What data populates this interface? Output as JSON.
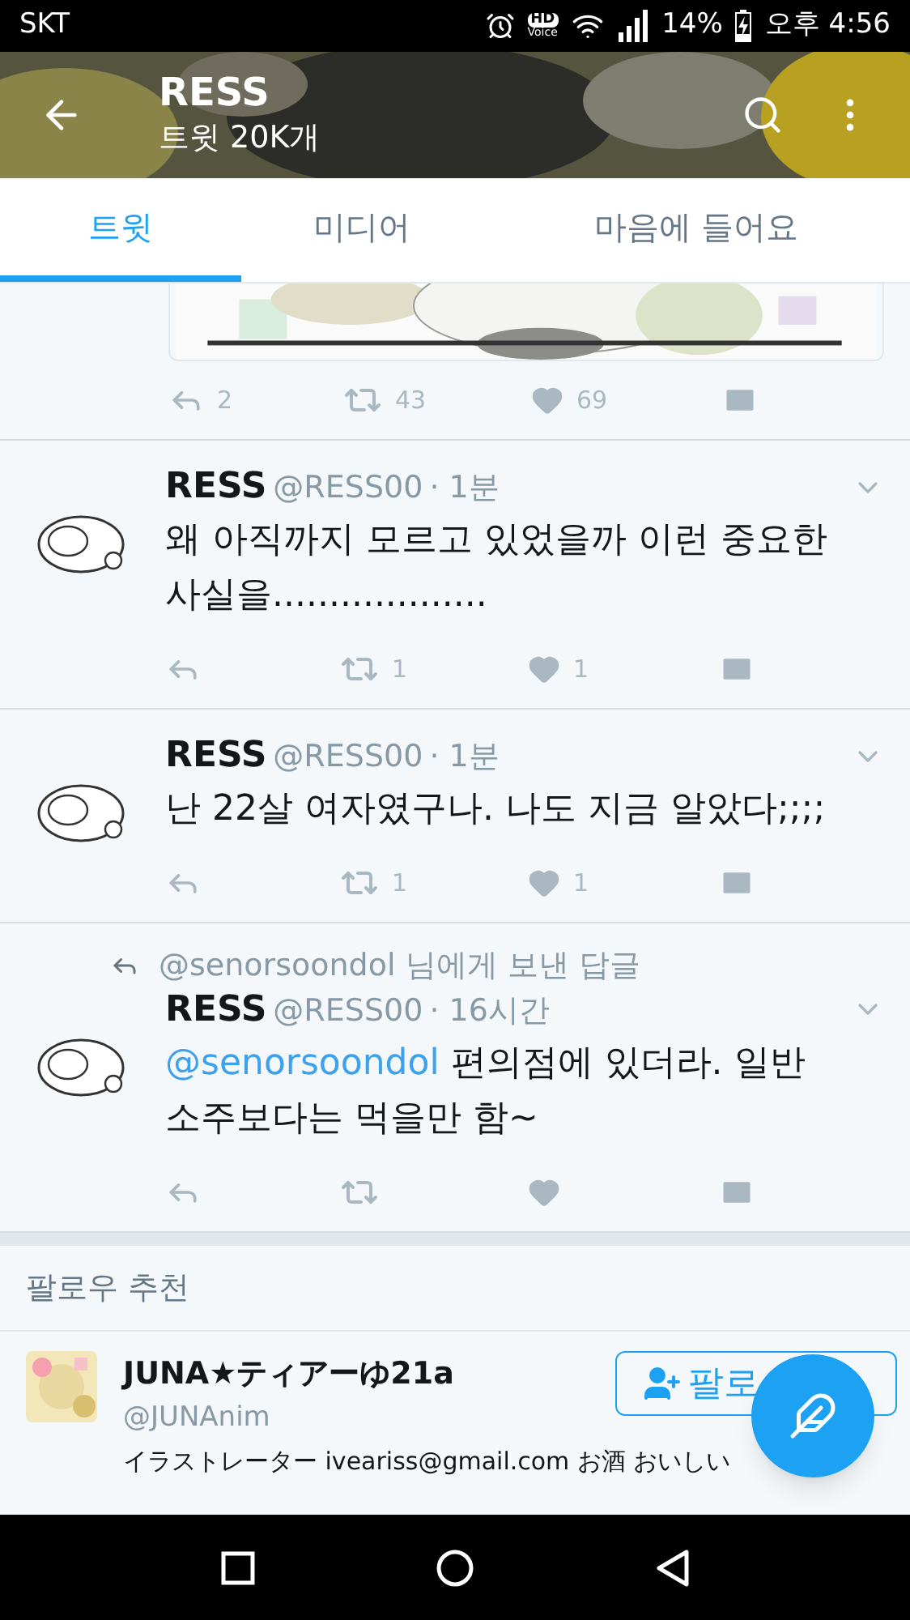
{
  "status_bar": {
    "carrier": "SKT",
    "hd": "HD",
    "voice": "Voice",
    "battery": "14%",
    "time": "오후 4:56"
  },
  "header": {
    "title": "RESS",
    "subtitle": "트윗 20K개"
  },
  "tabs": [
    {
      "label": "트윗",
      "selected": true
    },
    {
      "label": "미디어",
      "selected": false
    },
    {
      "label": "마음에 들어요",
      "selected": false
    }
  ],
  "partial_tweet": {
    "replies": "2",
    "retweets": "43",
    "likes": "69"
  },
  "tweets": [
    {
      "name": "RESS",
      "handle": "@RESS00",
      "time": "· 1분",
      "text": "왜 아직까지 모르고 있었을까 이런 중요한 사실을...................",
      "retweets": "1",
      "likes": "1"
    },
    {
      "name": "RESS",
      "handle": "@RESS00",
      "time": "· 1분",
      "text": "난 22살 여자였구나.  나도 지금 알았다;;;;",
      "retweets": "1",
      "likes": "1"
    },
    {
      "reply_to": "@senorsoondol 님에게 보낸 답글",
      "name": "RESS",
      "handle": "@RESS00",
      "time": "· 16시간",
      "mention": "@senorsoondol",
      "text": "편의점에 있더라.  일반 소주보다는 먹을만 함~"
    }
  ],
  "suggestions": {
    "title": "팔로우 추천",
    "users": [
      {
        "name": "JUNA★ティアーゆ21a",
        "handle": "@JUNAnim",
        "bio": "イラストレーター iveariss@gmail.com お酒 おいしい",
        "button": "팔로"
      }
    ]
  }
}
